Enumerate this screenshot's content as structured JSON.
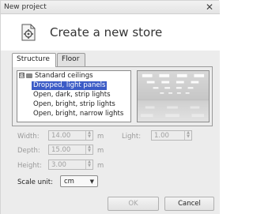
{
  "window": {
    "title": "New project",
    "close_glyph": "✕"
  },
  "header": {
    "title": "Create a new store",
    "icon": "store-settings-icon"
  },
  "tabs": [
    {
      "label": "Structure",
      "active": true
    },
    {
      "label": "Floor",
      "active": false
    }
  ],
  "tree": {
    "root": {
      "expander": "⊟",
      "label": "Standard ceilings"
    },
    "items": [
      {
        "label": "Dropped, light panels",
        "selected": true
      },
      {
        "label": "Open, dark, strip lights",
        "selected": false
      },
      {
        "label": "Open, bright, strip lights",
        "selected": false
      },
      {
        "label": "Open, bright, narrow lights",
        "selected": false
      }
    ]
  },
  "fields": {
    "width": {
      "label": "Width:",
      "value": "14.00",
      "unit": "m"
    },
    "depth": {
      "label": "Depth:",
      "value": "15.00",
      "unit": "m"
    },
    "height": {
      "label": "Height:",
      "value": "3.00",
      "unit": "m"
    },
    "light": {
      "label": "Light:",
      "value": "1.00"
    }
  },
  "scale": {
    "label": "Scale unit:",
    "value": "cm",
    "arrow": "▼"
  },
  "buttons": {
    "ok": "OK",
    "cancel": "Cancel"
  },
  "colors": {
    "selection": "#3b5bc6",
    "disabled_text": "#9a9a9a"
  }
}
